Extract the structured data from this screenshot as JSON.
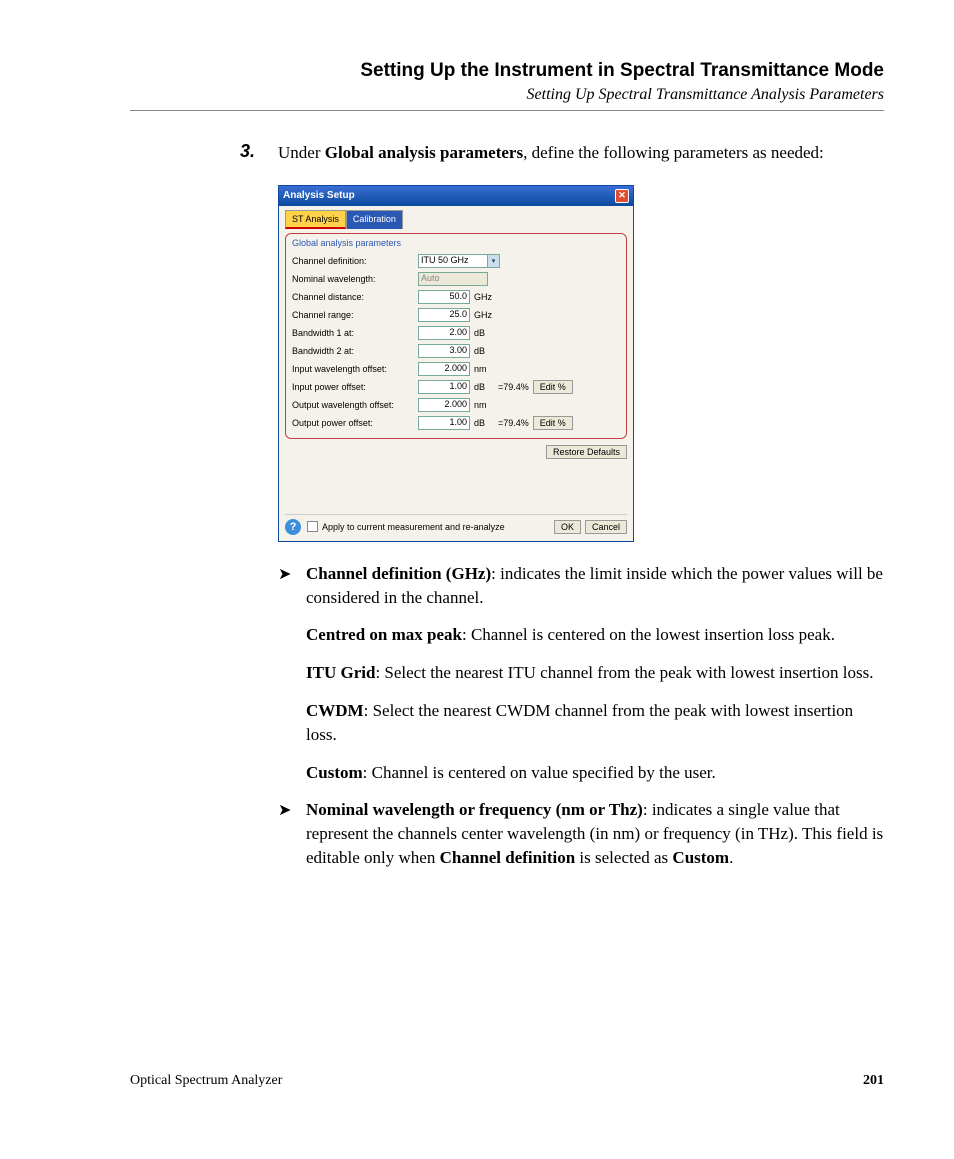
{
  "header": {
    "title": "Setting Up the Instrument in Spectral Transmittance Mode",
    "subtitle": "Setting Up Spectral Transmittance Analysis Parameters"
  },
  "step": {
    "num": "3.",
    "prefix": "Under ",
    "bold": "Global analysis parameters",
    "suffix": ", define the following parameters as needed:"
  },
  "dlg": {
    "title": "Analysis Setup",
    "tab_active": "ST Analysis",
    "tab_inactive": "Calibration",
    "group_title": "Global analysis parameters",
    "rows": {
      "ch_def_label": "Channel definition:",
      "ch_def_value": "ITU 50 GHz",
      "nom_wl_label": "Nominal wavelength:",
      "nom_wl_value": "Auto",
      "ch_dist_label": "Channel distance:",
      "ch_dist_value": "50.0",
      "ch_dist_unit": "GHz",
      "ch_range_label": "Channel range:",
      "ch_range_value": "25.0",
      "ch_range_unit": "GHz",
      "bw1_label": "Bandwidth 1 at:",
      "bw1_value": "2.00",
      "bw1_unit": "dB",
      "bw2_label": "Bandwidth 2 at:",
      "bw2_value": "3.00",
      "bw2_unit": "dB",
      "in_wl_off_label": "Input wavelength offset:",
      "in_wl_off_value": "2.000",
      "in_wl_off_unit": "nm",
      "in_pw_off_label": "Input power offset:",
      "in_pw_off_value": "1.00",
      "in_pw_off_unit": "dB",
      "in_pw_off_pct": "=79.4%",
      "out_wl_off_label": "Output wavelength offset:",
      "out_wl_off_value": "2.000",
      "out_wl_off_unit": "nm",
      "out_pw_off_label": "Output power offset:",
      "out_pw_off_value": "1.00",
      "out_pw_off_unit": "dB",
      "out_pw_off_pct": "=79.4%",
      "edit_pct": "Edit %",
      "restore": "Restore Defaults",
      "apply": "Apply to current measurement and re-analyze",
      "ok": "OK",
      "cancel": "Cancel"
    }
  },
  "bullets": {
    "b1_bold": "Channel definition (GHz)",
    "b1_text": ": indicates the limit inside which the power values will be considered in the channel.",
    "p1_bold": "Centred on max peak",
    "p1_text": ": Channel is centered on the lowest insertion loss peak.",
    "p2_bold": "ITU Grid",
    "p2_text": ": Select the nearest ITU channel from the peak with lowest insertion loss.",
    "p3_bold": "CWDM",
    "p3_text": ": Select the nearest CWDM channel from the peak with lowest insertion loss.",
    "p4_bold": "Custom",
    "p4_text": ": Channel is centered on value specified by the user.",
    "b2_bold": "Nominal wavelength or frequency (nm or Thz)",
    "b2_text1": ": indicates a single value that represent the channels center wavelength (in nm) or frequency (in THz). This field is editable only when ",
    "b2_bold2": "Channel definition",
    "b2_text2": " is selected as ",
    "b2_bold3": "Custom",
    "b2_text3": "."
  },
  "footer": {
    "left": "Optical Spectrum Analyzer",
    "right": "201"
  }
}
